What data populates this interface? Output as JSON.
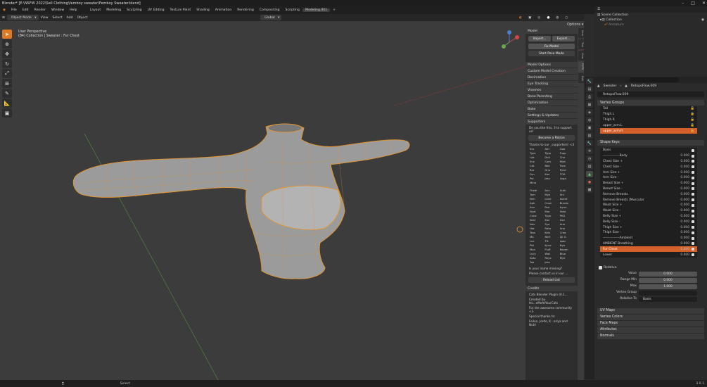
{
  "window": {
    "title": "Blender* [E:\\NSFW 2022\\Sell Clothing\\femboy sweater\\Femboy Sweater.blend]"
  },
  "menu": {
    "items": [
      "File",
      "Edit",
      "Render",
      "Window",
      "Help"
    ],
    "workspaces": [
      "Layout",
      "Modeling",
      "Sculpting",
      "UV Editing",
      "Texture Paint",
      "Shading",
      "Animation",
      "Rendering",
      "Compositing",
      "Scripting",
      "Modeling.001"
    ],
    "scene": "Scene",
    "view_layer": "View Layer"
  },
  "header3d": {
    "mode": "Object Mode",
    "view": "View",
    "select": "Select",
    "add": "Add",
    "object": "Object",
    "orientation": "Global",
    "options": "Options"
  },
  "viewport": {
    "perspective": "User Perspective",
    "collection": "(84) Collection | Sweater : Fur Chest"
  },
  "npanel": {
    "tabs": [
      "Item",
      "Tool",
      "View",
      "CATS",
      "Edit"
    ],
    "model_header": "Model",
    "import": "Import...",
    "export": "Export...",
    "fix_model": "Fix Model",
    "start_pose": "Start Pose Mode",
    "sections": [
      "Model Options",
      "Custom Model Creation",
      "Decimation",
      "Eye Tracking",
      "Visemes",
      "Bone Parenting",
      "Optimization",
      "Bake",
      "Settings & Updates",
      "Supporters"
    ],
    "support_q": "Do you like this, 3 to support us!",
    "patron": "Become a Patron",
    "thanks": "Thanks to our _supporters! <3",
    "supporters_a": [
      "Kru",
      "Atri",
      "Goo",
      "Typs",
      "Typp",
      "Tupp",
      "Lak",
      "Doll",
      "Cha",
      "Enz",
      "Com",
      "Mint",
      "Cat",
      "Bee",
      "Fore",
      "Bur",
      "Gnu",
      "Pyon",
      "Fun",
      "Kan",
      "TOR",
      "Pol",
      "Jess",
      "Lega",
      "Mina"
    ],
    "supporters_b": [
      "Firedr",
      "Ann",
      "Auth",
      "Tom",
      "Myk",
      "Ahi",
      "Nim",
      "Lone",
      "Avent",
      "Aph",
      "Crow",
      "Bunda",
      "Sen",
      "Peri",
      "Hynn",
      "Nyal",
      "Mar",
      "Yaha",
      "Crow",
      "Tyga",
      "PKG",
      "Kest",
      "Kaz",
      "Uso",
      "Nev",
      "Sya",
      "Ana",
      "Hat",
      "Rata",
      "Ana",
      "Tess",
      "Kely",
      "Crea",
      "Mo",
      "Bert",
      "Zji G",
      "Luc",
      "TD",
      "spac",
      "Pet",
      "Kyne",
      "Nya",
      "Mon",
      "Fluff",
      "Raven",
      "Lucy",
      "Wall",
      "Blue",
      "Kato",
      "Reyx",
      "Mye",
      "Toa",
      "jess",
      ""
    ],
    "missing_q": "Is your name missing?",
    "missing_c": "Please contact us in our ...",
    "reload": "Reload List",
    "credits": "Credits",
    "cats_plugin": "Cats Blender Plugin (0.1...",
    "created": "Created by Ho...eMeAtYourCats",
    "for_vrchat": "For the awesome community <3",
    "special": "Special thanks to:",
    "names": "Feilen, Jordo, K...ariya and Nutri"
  },
  "outliner": {
    "scene_collection": "Scene Collection",
    "collection": "Collection",
    "armature": "Armature"
  },
  "props": {
    "object": "Sweater",
    "data": "RetopoFlow.009",
    "mesh": "RetopoFlow.009",
    "vertex_groups_hdr": "Vertex Groups",
    "vertex_groups": [
      "Tail",
      "Thigh.L",
      "Thigh.R",
      "upper_arm.L",
      "upper_arm.R"
    ],
    "selected_vg": "upper_arm.R",
    "shape_keys_hdr": "Shape Keys",
    "shape_keys": [
      {
        "name": "Basis",
        "value": ""
      },
      {
        "name": "---------------Body",
        "value": "0.000"
      },
      {
        "name": "Chest Size +",
        "value": "0.000"
      },
      {
        "name": "Chest Size -",
        "value": "0.000"
      },
      {
        "name": "Arm Size +",
        "value": "0.000"
      },
      {
        "name": "Arm Size -",
        "value": "0.000"
      },
      {
        "name": "Breast Size +",
        "value": "0.000"
      },
      {
        "name": "Breast Size -",
        "value": "0.000"
      },
      {
        "name": "Remove Breasts",
        "value": "0.000"
      },
      {
        "name": "Remove Breasts (Muscular",
        "value": "0.000"
      },
      {
        "name": "Waist Size +",
        "value": "0.000"
      },
      {
        "name": "Waist Size -",
        "value": "0.000"
      },
      {
        "name": "Belly Size +",
        "value": "0.000"
      },
      {
        "name": "Belly Size -",
        "value": "0.000"
      },
      {
        "name": "Thigh Size +",
        "value": "0.000"
      },
      {
        "name": "Thigh Size -",
        "value": "0.000"
      },
      {
        "name": "---------------Ambient",
        "value": "0.000"
      },
      {
        "name": "AMBIENT Breathing",
        "value": "0.000"
      },
      {
        "name": "Fur Chest",
        "value": "0.000"
      },
      {
        "name": "Lower",
        "value": "0.000"
      }
    ],
    "selected_sk": "Fur Chest",
    "relative": "Relative",
    "value_lbl": "Value",
    "value": "0.000",
    "range_min_lbl": "Range Min",
    "range_min": "0.000",
    "max_lbl": "Max",
    "max": "1.000",
    "vertex_group_lbl": "Vertex Group",
    "relative_to_lbl": "Relative To",
    "relative_to": "Basis",
    "collapsed": [
      "UV Maps",
      "Vertex Colors",
      "Face Maps",
      "Attributes",
      "Normals"
    ]
  },
  "status": {
    "select": "Select",
    "version": "3.0.1"
  },
  "colors": {
    "accent": "#e07b24",
    "selection": "#d5612a",
    "mesh_wire": "#e8962c"
  }
}
